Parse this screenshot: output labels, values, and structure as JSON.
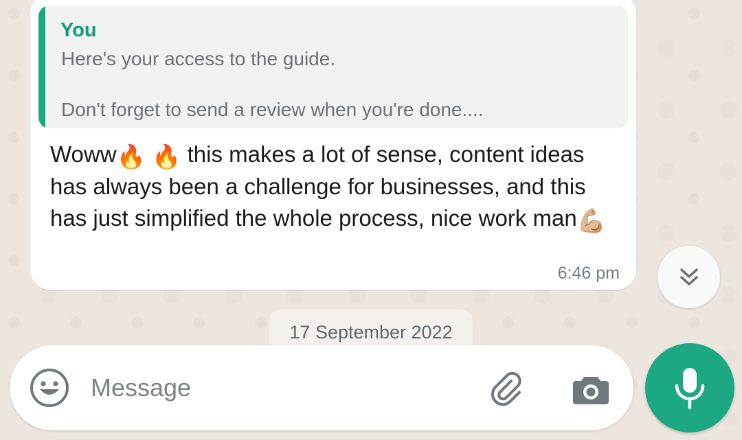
{
  "message": {
    "quote_author": "You",
    "quote_text": "Here's your access to the guide.\n\nDon't forget to send a review when you're done....",
    "text_part1": "Woww",
    "emoji_fire": "🔥",
    "text_part2": "this makes a lot of sense, content ideas has always been a challenge for businesses, and this has just simplified the whole process, nice work man",
    "emoji_muscle": "💪🏼",
    "time": "6:46 pm"
  },
  "date_separator": "17 September 2022",
  "composer": {
    "placeholder": "Message"
  },
  "icons": {
    "scroll": "chevrons-down-icon",
    "emoji": "smiley-icon",
    "attach": "paperclip-icon",
    "camera": "camera-icon",
    "mic": "microphone-icon"
  },
  "colors": {
    "accent": "#1DA884",
    "quote_author": "#0C9D76",
    "wallpaper": "#ECE5DD"
  }
}
